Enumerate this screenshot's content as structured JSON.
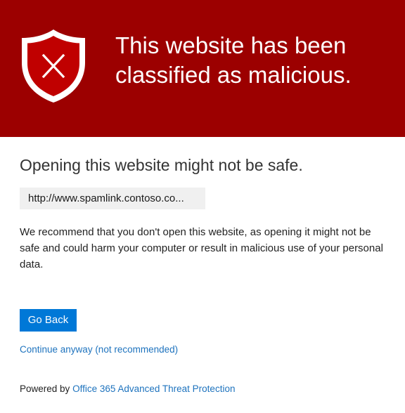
{
  "banner": {
    "title": "This website has been classified as malicious.",
    "shield_icon": "shield-x-icon",
    "background_color": "#9c0000"
  },
  "main": {
    "subheading": "Opening this website might not be safe.",
    "url": "http://www.spamlink.contoso.co...",
    "description": "We recommend that you don't open this website, as opening it might not be safe and could harm your computer or result in malicious use of your personal data."
  },
  "actions": {
    "go_back_label": "Go Back",
    "continue_label": "Continue anyway (not recommended)",
    "accent_color": "#0078d7"
  },
  "footer": {
    "powered_by_prefix": "Powered by",
    "powered_by_link": "Office 365 Advanced Threat Protection"
  }
}
